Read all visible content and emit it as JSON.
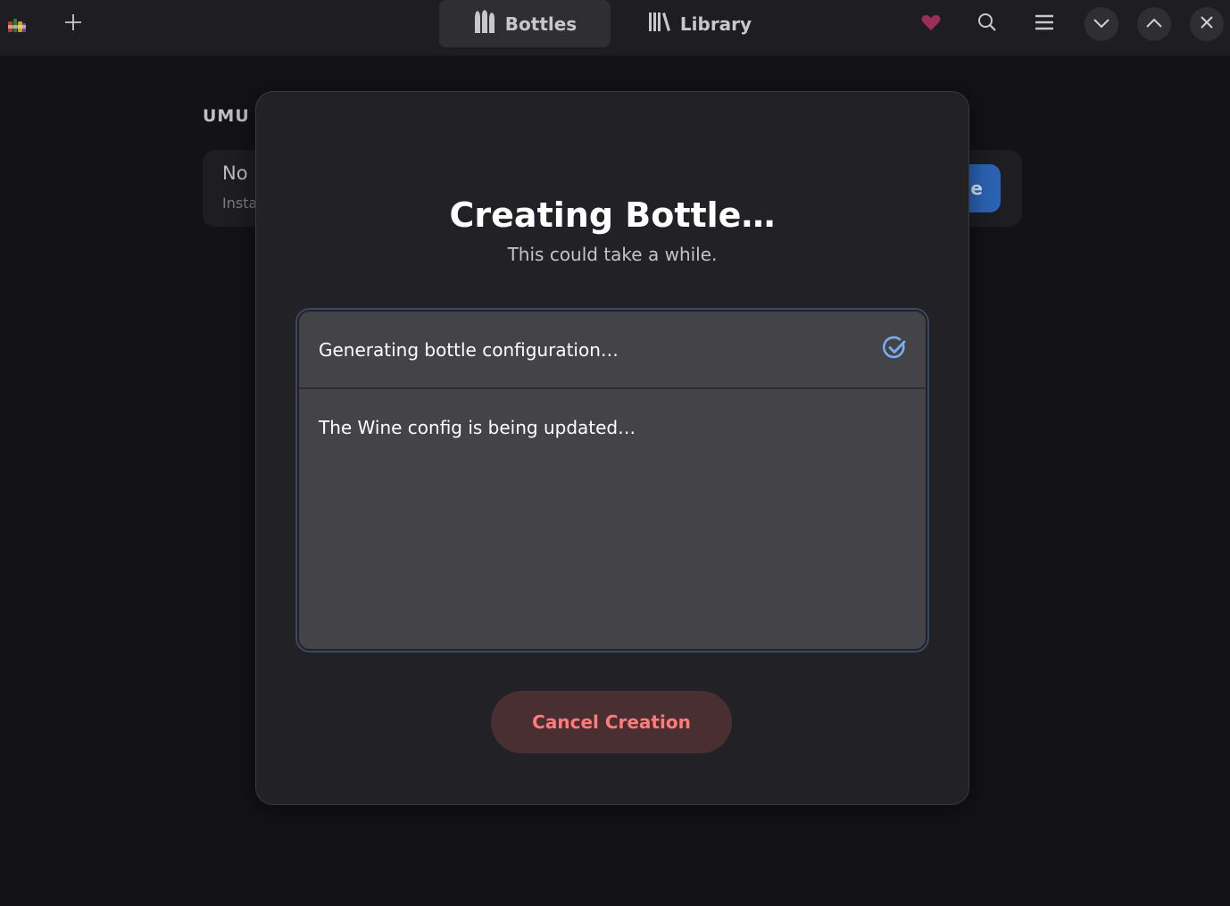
{
  "headerbar": {
    "tabs": [
      {
        "label": "Bottles",
        "icon": "bottles-icon",
        "active": true
      },
      {
        "label": "Library",
        "icon": "library-icon",
        "active": false
      }
    ],
    "icons": [
      "app-icon",
      "add-icon",
      "heart-icon",
      "search-icon",
      "menu-icon",
      "chevron-down-icon",
      "chevron-up-icon",
      "close-icon"
    ],
    "heart_color": "#9b2f5a"
  },
  "background": {
    "section_title": "UMU",
    "card_title": "No",
    "card_subtitle": "Insta",
    "card_button": "ne"
  },
  "dialog": {
    "title": "Creating Bottle…",
    "subtitle": "This could take a while.",
    "step": {
      "label": "Generating bottle configuration…",
      "status_icon": "check-circle-icon",
      "status_color": "#78aeed"
    },
    "status_text": "The Wine config is being updated…",
    "cancel_label": "Cancel Creation",
    "cancel_color": "#ff7b7b"
  }
}
